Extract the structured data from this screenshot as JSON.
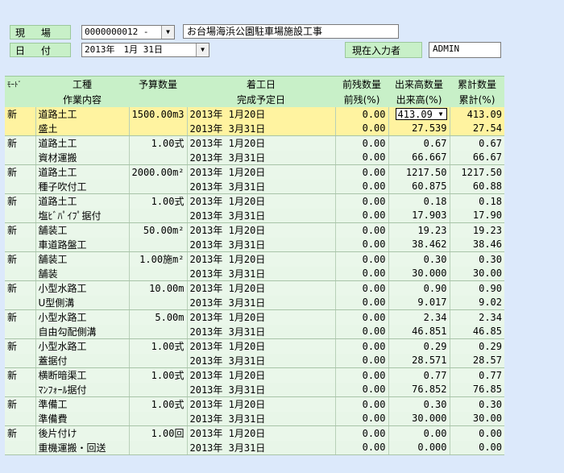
{
  "header": {
    "site_label": "現 場",
    "site_code": "0000000012 -",
    "site_name": "お台場海浜公園駐車場施設工事",
    "date_label": "日 付",
    "date_value": "2013年　1月 31日",
    "input_person_label": "現在入力者",
    "input_person_value": "ADMIN"
  },
  "table": {
    "columns": {
      "mode": "ﾓｰﾄﾞ",
      "work_type": "工種",
      "work_content": "作業内容",
      "budget_qty": "予算数量",
      "start_date": "着工日",
      "planned_end": "完成予定日",
      "prev_remaining_qty": "前残数量",
      "prev_remaining_pct": "前残(%)",
      "output_qty": "出来高数量",
      "output_pct": "出来高(%)",
      "cumulative_qty": "累計数量",
      "cumulative_pct": "累計(%)"
    },
    "rows": [
      {
        "mode": "新",
        "work_type": "道路土工",
        "work_content": "盛土",
        "budget_qty": "1500.00m3",
        "start_date": "2013年 1月20日",
        "planned_end": "2013年 3月31日",
        "prev_qty": "0.00",
        "prev_pct": "0.00",
        "output_qty": "413.09",
        "output_pct": "27.539",
        "cum_qty": "413.09",
        "cum_pct": "27.54",
        "selected": true
      },
      {
        "mode": "新",
        "work_type": "道路土工",
        "work_content": "資材運搬",
        "budget_qty": "1.00式",
        "start_date": "2013年 1月20日",
        "planned_end": "2013年 3月31日",
        "prev_qty": "0.00",
        "prev_pct": "0.00",
        "output_qty": "0.67",
        "output_pct": "66.667",
        "cum_qty": "0.67",
        "cum_pct": "66.67"
      },
      {
        "mode": "新",
        "work_type": "道路土工",
        "work_content": "種子吹付工",
        "budget_qty": "2000.00m²",
        "start_date": "2013年 1月20日",
        "planned_end": "2013年 3月31日",
        "prev_qty": "0.00",
        "prev_pct": "0.00",
        "output_qty": "1217.50",
        "output_pct": "60.875",
        "cum_qty": "1217.50",
        "cum_pct": "60.88"
      },
      {
        "mode": "新",
        "work_type": "道路土工",
        "work_content": "塩ﾋﾞﾊﾟｲﾌﾟ据付",
        "budget_qty": "1.00式",
        "start_date": "2013年 1月20日",
        "planned_end": "2013年 3月31日",
        "prev_qty": "0.00",
        "prev_pct": "0.00",
        "output_qty": "0.18",
        "output_pct": "17.903",
        "cum_qty": "0.18",
        "cum_pct": "17.90"
      },
      {
        "mode": "新",
        "work_type": "舗装工",
        "work_content": "車道路盤工",
        "budget_qty": "50.00m²",
        "start_date": "2013年 1月20日",
        "planned_end": "2013年 3月31日",
        "prev_qty": "0.00",
        "prev_pct": "0.00",
        "output_qty": "19.23",
        "output_pct": "38.462",
        "cum_qty": "19.23",
        "cum_pct": "38.46"
      },
      {
        "mode": "新",
        "work_type": "舗装工",
        "work_content": "舗装",
        "budget_qty": "1.00施m²",
        "start_date": "2013年 1月20日",
        "planned_end": "2013年 3月31日",
        "prev_qty": "0.00",
        "prev_pct": "0.00",
        "output_qty": "0.30",
        "output_pct": "30.000",
        "cum_qty": "0.30",
        "cum_pct": "30.00"
      },
      {
        "mode": "新",
        "work_type": "小型水路工",
        "work_content": "U型側溝",
        "budget_qty": "10.00m",
        "start_date": "2013年 1月20日",
        "planned_end": "2013年 3月31日",
        "prev_qty": "0.00",
        "prev_pct": "0.00",
        "output_qty": "0.90",
        "output_pct": "9.017",
        "cum_qty": "0.90",
        "cum_pct": "9.02"
      },
      {
        "mode": "新",
        "work_type": "小型水路工",
        "work_content": "自由勾配側溝",
        "budget_qty": "5.00m",
        "start_date": "2013年 1月20日",
        "planned_end": "2013年 3月31日",
        "prev_qty": "0.00",
        "prev_pct": "0.00",
        "output_qty": "2.34",
        "output_pct": "46.851",
        "cum_qty": "2.34",
        "cum_pct": "46.85"
      },
      {
        "mode": "新",
        "work_type": "小型水路工",
        "work_content": "蓋据付",
        "budget_qty": "1.00式",
        "start_date": "2013年 1月20日",
        "planned_end": "2013年 3月31日",
        "prev_qty": "0.00",
        "prev_pct": "0.00",
        "output_qty": "0.29",
        "output_pct": "28.571",
        "cum_qty": "0.29",
        "cum_pct": "28.57"
      },
      {
        "mode": "新",
        "work_type": "横断暗渠工",
        "work_content": "ﾏﾝﾌｫｰﾙ据付",
        "budget_qty": "1.00式",
        "start_date": "2013年 1月20日",
        "planned_end": "2013年 3月31日",
        "prev_qty": "0.00",
        "prev_pct": "0.00",
        "output_qty": "0.77",
        "output_pct": "76.852",
        "cum_qty": "0.77",
        "cum_pct": "76.85"
      },
      {
        "mode": "新",
        "work_type": "準備工",
        "work_content": "準備費",
        "budget_qty": "1.00式",
        "start_date": "2013年 1月20日",
        "planned_end": "2013年 3月31日",
        "prev_qty": "0.00",
        "prev_pct": "0.00",
        "output_qty": "0.30",
        "output_pct": "30.000",
        "cum_qty": "0.30",
        "cum_pct": "30.00"
      },
      {
        "mode": "新",
        "work_type": "後片付け",
        "work_content": "重機運搬・回送",
        "budget_qty": "1.00回",
        "start_date": "2013年 1月20日",
        "planned_end": "2013年 3月31日",
        "prev_qty": "0.00",
        "prev_pct": "0.00",
        "output_qty": "0.00",
        "output_pct": "0.000",
        "cum_qty": "0.00",
        "cum_pct": "0.00"
      }
    ]
  },
  "colors": {
    "window_bg": "#dce9fb",
    "header_green": "#c8f0c8",
    "row_green": "#eaf7ea",
    "selected_row": "#fff3a0"
  },
  "icons": [
    "dropdown-arrow-icon"
  ]
}
